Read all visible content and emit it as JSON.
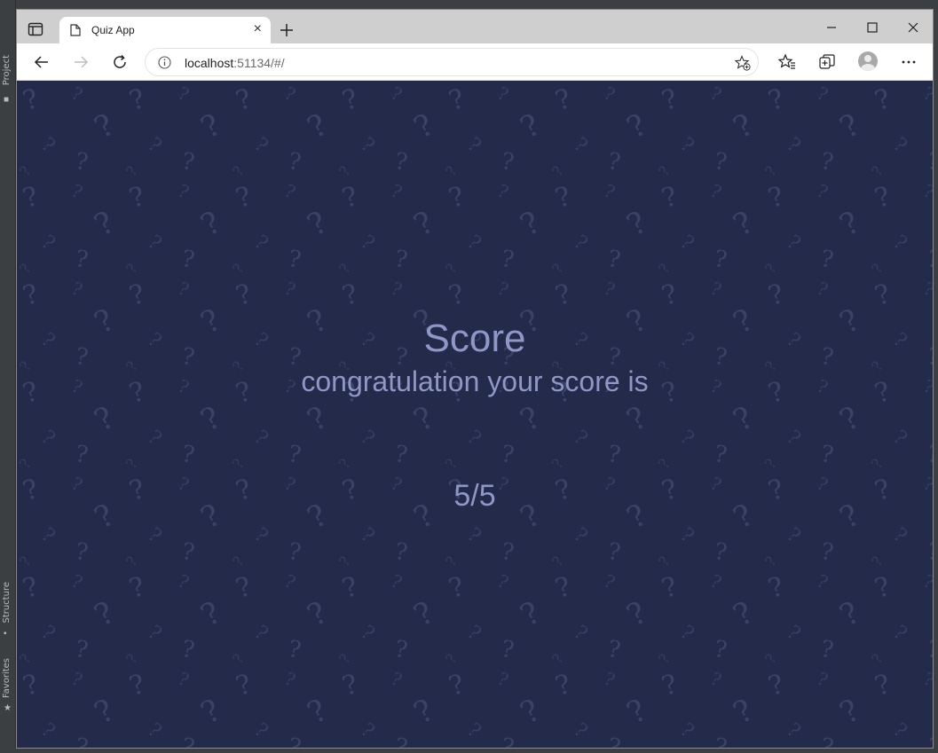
{
  "ide": {
    "project_tab": "Project",
    "structure_tab": "Structure",
    "favorites_tab": "Favorites"
  },
  "browser": {
    "tab_title": "Quiz App",
    "url_host": "localhost",
    "url_rest": ":51134/#/"
  },
  "score": {
    "title": "Score",
    "subtitle": "congratulation your score is",
    "value": "5/5"
  },
  "colors": {
    "page_background": "#232a4a",
    "text": "#8f97c7",
    "pattern": "#3a4266"
  },
  "icons": {
    "tab_actions": "tab-actions-icon",
    "tab_page": "page-icon",
    "tab_close": "close-icon",
    "new_tab": "plus-icon",
    "minimize": "minimize-icon",
    "maximize": "maximize-icon",
    "window_close": "close-icon",
    "back": "arrow-left-icon",
    "forward": "arrow-right-icon",
    "refresh": "refresh-icon",
    "site_info": "info-icon",
    "add_favorite": "star-plus-icon",
    "favorites": "favorites-icon",
    "collections": "collections-icon",
    "profile": "avatar",
    "menu": "more-icon"
  }
}
